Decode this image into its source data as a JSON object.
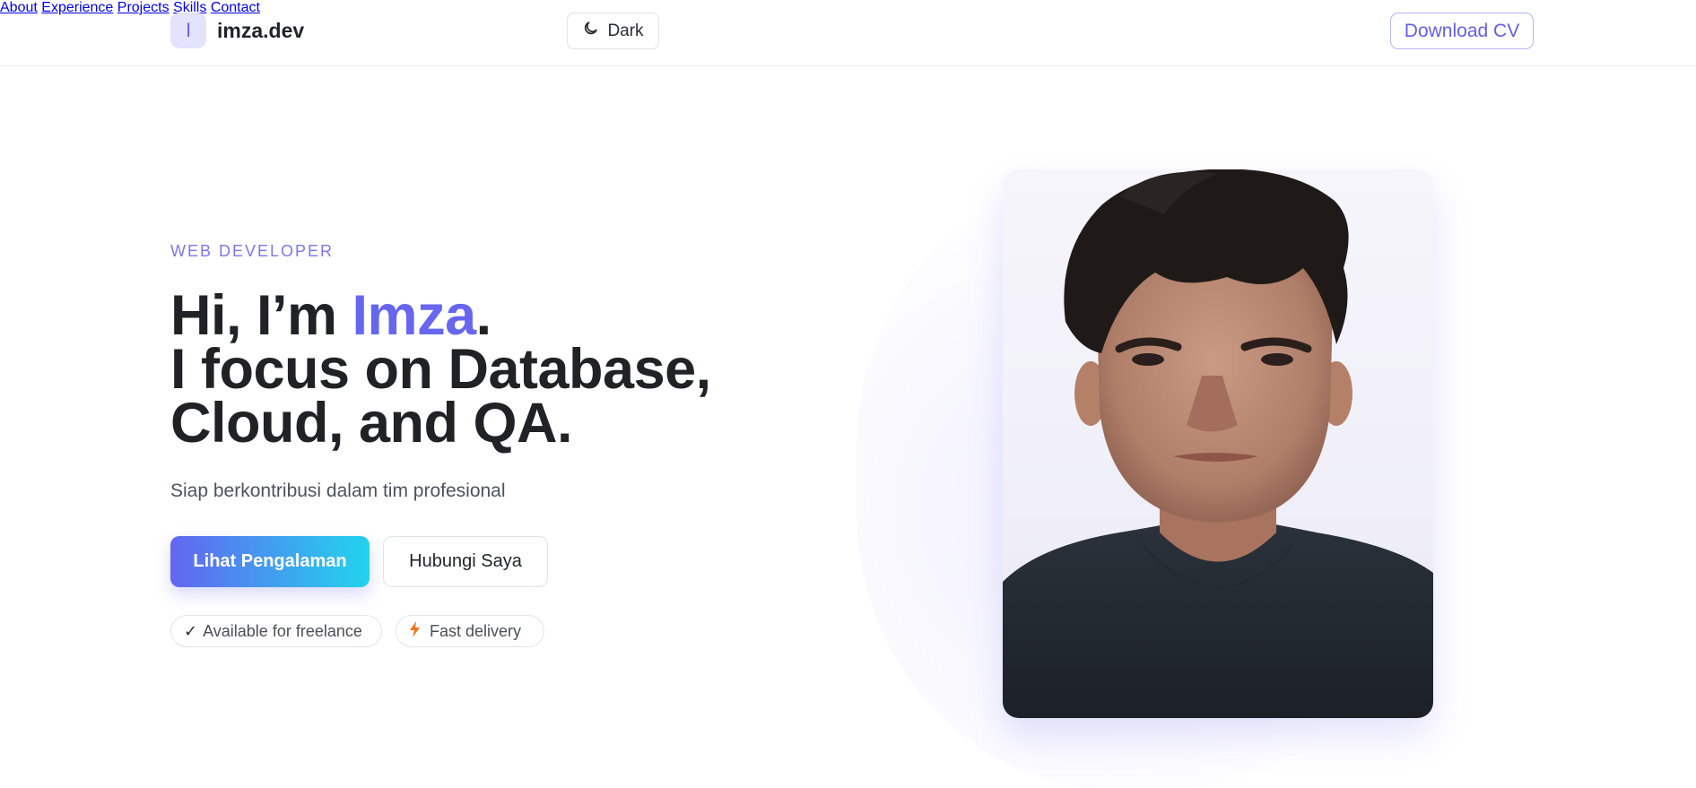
{
  "brand": {
    "badge": "I",
    "name": "imza.dev"
  },
  "theme_toggle": {
    "label": "Dark",
    "icon": "moon-icon"
  },
  "nav": {
    "items": [
      {
        "label": "About"
      },
      {
        "label": "Experience"
      },
      {
        "label": "Projects"
      },
      {
        "label": "Skills"
      },
      {
        "label": "Contact"
      }
    ],
    "cta": "Download CV"
  },
  "hero": {
    "eyebrow": "WEB DEVELOPER",
    "greeting_prefix": "Hi, I’m ",
    "name": "Imza",
    "greeting_suffix": ".",
    "line2": "I focus on Database,",
    "line3": "Cloud, and QA.",
    "subtitle": "Siap berkontribusi dalam tim profesional",
    "primary_button": "Lihat Pengalaman",
    "secondary_button": "Hubungi Saya",
    "chips": [
      {
        "icon": "check-icon",
        "glyph": "✓",
        "label": "Available for freelance"
      },
      {
        "icon": "lightning-icon",
        "label": "Fast delivery"
      }
    ]
  },
  "colors": {
    "accent": "#6366f1",
    "accent_end": "#22d3ee",
    "highlight_text": "#6666ee",
    "lightning": "#f97316"
  }
}
